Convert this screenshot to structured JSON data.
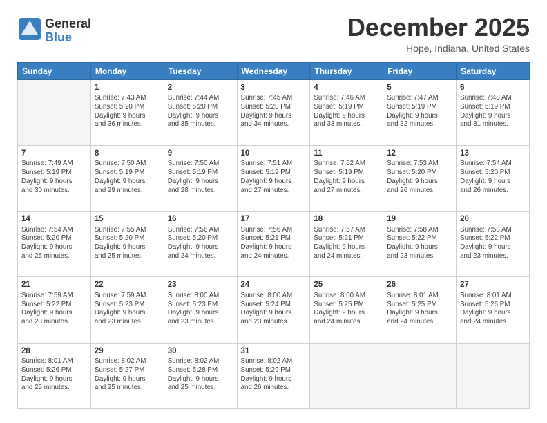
{
  "logo": {
    "line1": "General",
    "line2": "Blue"
  },
  "header": {
    "month": "December 2025",
    "location": "Hope, Indiana, United States"
  },
  "weekdays": [
    "Sunday",
    "Monday",
    "Tuesday",
    "Wednesday",
    "Thursday",
    "Friday",
    "Saturday"
  ],
  "weeks": [
    [
      {
        "day": "",
        "info": ""
      },
      {
        "day": "1",
        "info": "Sunrise: 7:43 AM\nSunset: 5:20 PM\nDaylight: 9 hours\nand 36 minutes."
      },
      {
        "day": "2",
        "info": "Sunrise: 7:44 AM\nSunset: 5:20 PM\nDaylight: 9 hours\nand 35 minutes."
      },
      {
        "day": "3",
        "info": "Sunrise: 7:45 AM\nSunset: 5:20 PM\nDaylight: 9 hours\nand 34 minutes."
      },
      {
        "day": "4",
        "info": "Sunrise: 7:46 AM\nSunset: 5:19 PM\nDaylight: 9 hours\nand 33 minutes."
      },
      {
        "day": "5",
        "info": "Sunrise: 7:47 AM\nSunset: 5:19 PM\nDaylight: 9 hours\nand 32 minutes."
      },
      {
        "day": "6",
        "info": "Sunrise: 7:48 AM\nSunset: 5:19 PM\nDaylight: 9 hours\nand 31 minutes."
      }
    ],
    [
      {
        "day": "7",
        "info": "Sunrise: 7:49 AM\nSunset: 5:19 PM\nDaylight: 9 hours\nand 30 minutes."
      },
      {
        "day": "8",
        "info": "Sunrise: 7:50 AM\nSunset: 5:19 PM\nDaylight: 9 hours\nand 29 minutes."
      },
      {
        "day": "9",
        "info": "Sunrise: 7:50 AM\nSunset: 5:19 PM\nDaylight: 9 hours\nand 28 minutes."
      },
      {
        "day": "10",
        "info": "Sunrise: 7:51 AM\nSunset: 5:19 PM\nDaylight: 9 hours\nand 27 minutes."
      },
      {
        "day": "11",
        "info": "Sunrise: 7:52 AM\nSunset: 5:19 PM\nDaylight: 9 hours\nand 27 minutes."
      },
      {
        "day": "12",
        "info": "Sunrise: 7:53 AM\nSunset: 5:20 PM\nDaylight: 9 hours\nand 26 minutes."
      },
      {
        "day": "13",
        "info": "Sunrise: 7:54 AM\nSunset: 5:20 PM\nDaylight: 9 hours\nand 26 minutes."
      }
    ],
    [
      {
        "day": "14",
        "info": "Sunrise: 7:54 AM\nSunset: 5:20 PM\nDaylight: 9 hours\nand 25 minutes."
      },
      {
        "day": "15",
        "info": "Sunrise: 7:55 AM\nSunset: 5:20 PM\nDaylight: 9 hours\nand 25 minutes."
      },
      {
        "day": "16",
        "info": "Sunrise: 7:56 AM\nSunset: 5:20 PM\nDaylight: 9 hours\nand 24 minutes."
      },
      {
        "day": "17",
        "info": "Sunrise: 7:56 AM\nSunset: 5:21 PM\nDaylight: 9 hours\nand 24 minutes."
      },
      {
        "day": "18",
        "info": "Sunrise: 7:57 AM\nSunset: 5:21 PM\nDaylight: 9 hours\nand 24 minutes."
      },
      {
        "day": "19",
        "info": "Sunrise: 7:58 AM\nSunset: 5:22 PM\nDaylight: 9 hours\nand 23 minutes."
      },
      {
        "day": "20",
        "info": "Sunrise: 7:58 AM\nSunset: 5:22 PM\nDaylight: 9 hours\nand 23 minutes."
      }
    ],
    [
      {
        "day": "21",
        "info": "Sunrise: 7:59 AM\nSunset: 5:22 PM\nDaylight: 9 hours\nand 23 minutes."
      },
      {
        "day": "22",
        "info": "Sunrise: 7:59 AM\nSunset: 5:23 PM\nDaylight: 9 hours\nand 23 minutes."
      },
      {
        "day": "23",
        "info": "Sunrise: 8:00 AM\nSunset: 5:23 PM\nDaylight: 9 hours\nand 23 minutes."
      },
      {
        "day": "24",
        "info": "Sunrise: 8:00 AM\nSunset: 5:24 PM\nDaylight: 9 hours\nand 23 minutes."
      },
      {
        "day": "25",
        "info": "Sunrise: 8:00 AM\nSunset: 5:25 PM\nDaylight: 9 hours\nand 24 minutes."
      },
      {
        "day": "26",
        "info": "Sunrise: 8:01 AM\nSunset: 5:25 PM\nDaylight: 9 hours\nand 24 minutes."
      },
      {
        "day": "27",
        "info": "Sunrise: 8:01 AM\nSunset: 5:26 PM\nDaylight: 9 hours\nand 24 minutes."
      }
    ],
    [
      {
        "day": "28",
        "info": "Sunrise: 8:01 AM\nSunset: 5:26 PM\nDaylight: 9 hours\nand 25 minutes."
      },
      {
        "day": "29",
        "info": "Sunrise: 8:02 AM\nSunset: 5:27 PM\nDaylight: 9 hours\nand 25 minutes."
      },
      {
        "day": "30",
        "info": "Sunrise: 8:02 AM\nSunset: 5:28 PM\nDaylight: 9 hours\nand 25 minutes."
      },
      {
        "day": "31",
        "info": "Sunrise: 8:02 AM\nSunset: 5:29 PM\nDaylight: 9 hours\nand 26 minutes."
      },
      {
        "day": "",
        "info": ""
      },
      {
        "day": "",
        "info": ""
      },
      {
        "day": "",
        "info": ""
      }
    ]
  ]
}
